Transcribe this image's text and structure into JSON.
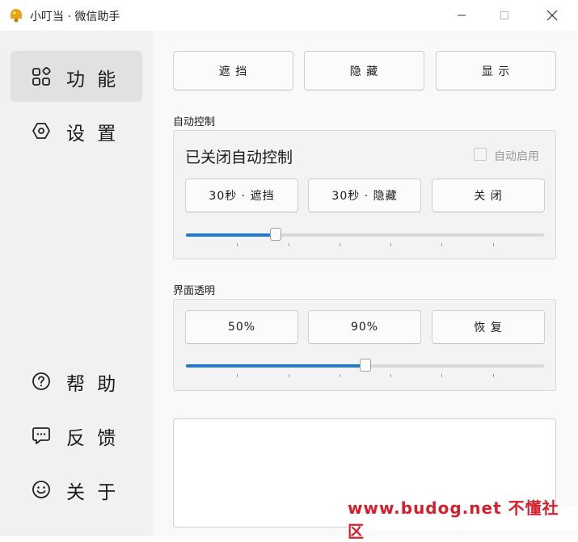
{
  "window": {
    "title": "小叮当 · 微信助手",
    "accent": "#1f78d1"
  },
  "sidebar": {
    "items": [
      {
        "label": "功 能",
        "icon": "grid-icon",
        "active": true
      },
      {
        "label": "设 置",
        "icon": "hexagon-settings-icon",
        "active": false
      },
      {
        "label": "帮 助",
        "icon": "question-icon",
        "active": false
      },
      {
        "label": "反 馈",
        "icon": "feedback-chat-icon",
        "active": false
      },
      {
        "label": "关 于",
        "icon": "smile-icon",
        "active": false
      }
    ]
  },
  "main": {
    "top_buttons": [
      "遮 挡",
      "隐 藏",
      "显 示"
    ],
    "auto_control": {
      "section_label": "自动控制",
      "status": "已关闭自动控制",
      "auto_start_label": "自动启用",
      "auto_start_checked": false,
      "buttons": [
        "30秒 · 遮挡",
        "30秒 · 隐藏",
        "关 闭"
      ],
      "slider_value_percent": 25
    },
    "transparency": {
      "section_label": "界面透明",
      "buttons": [
        "50%",
        "90%",
        "恢 复"
      ],
      "slider_value_percent": 50
    },
    "log_text": ""
  },
  "watermark": "www.budog.net 不懂社区"
}
